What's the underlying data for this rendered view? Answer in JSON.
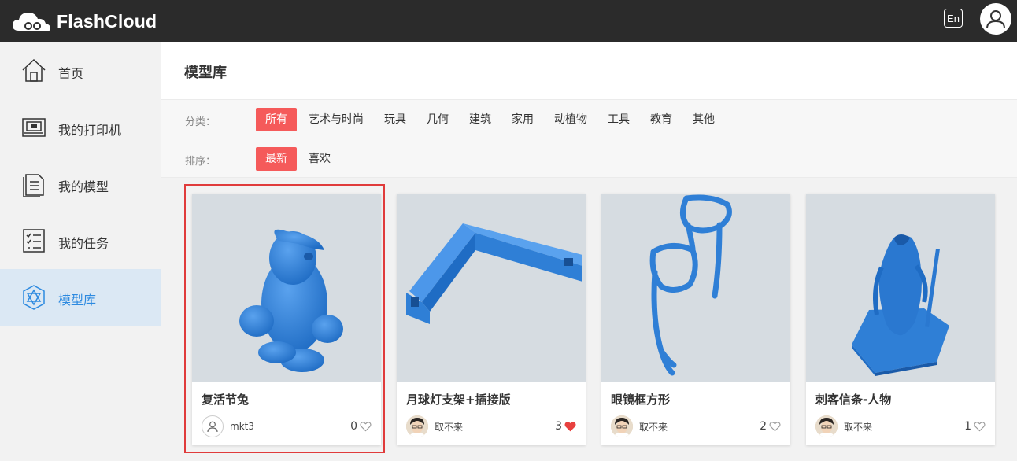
{
  "header": {
    "brand": "FlashCloud",
    "lang_label": "En"
  },
  "sidebar": {
    "items": [
      {
        "label": "首页",
        "icon": "home-icon"
      },
      {
        "label": "我的打印机",
        "icon": "printer-icon"
      },
      {
        "label": "我的模型",
        "icon": "document-icon"
      },
      {
        "label": "我的任务",
        "icon": "task-list-icon"
      },
      {
        "label": "模型库",
        "icon": "model-library-icon",
        "active": true
      }
    ]
  },
  "main": {
    "title": "模型库",
    "filters": {
      "category_label": "分类：",
      "categories": [
        "所有",
        "艺术与时尚",
        "玩具",
        "几何",
        "建筑",
        "家用",
        "动植物",
        "工具",
        "教育",
        "其他"
      ],
      "selected_category": "所有",
      "sort_label": "排序：",
      "sorts": [
        "最新",
        "喜欢"
      ],
      "selected_sort": "最新"
    },
    "models": [
      {
        "title": "复活节兔",
        "author": "mkt3",
        "likes": "0",
        "liked": false
      },
      {
        "title": "月球灯支架+插接版",
        "author": "取不来",
        "likes": "3",
        "liked": true
      },
      {
        "title": "眼镜框方形",
        "author": "取不来",
        "likes": "2",
        "liked": false
      },
      {
        "title": "刺客信条-人物",
        "author": "取不来",
        "likes": "1",
        "liked": false
      }
    ]
  },
  "colors": {
    "accent": "#f55a5a",
    "active_blue": "#2d8ae0",
    "model_blue": "#2f7fd6",
    "highlight": "#e03b3b"
  }
}
